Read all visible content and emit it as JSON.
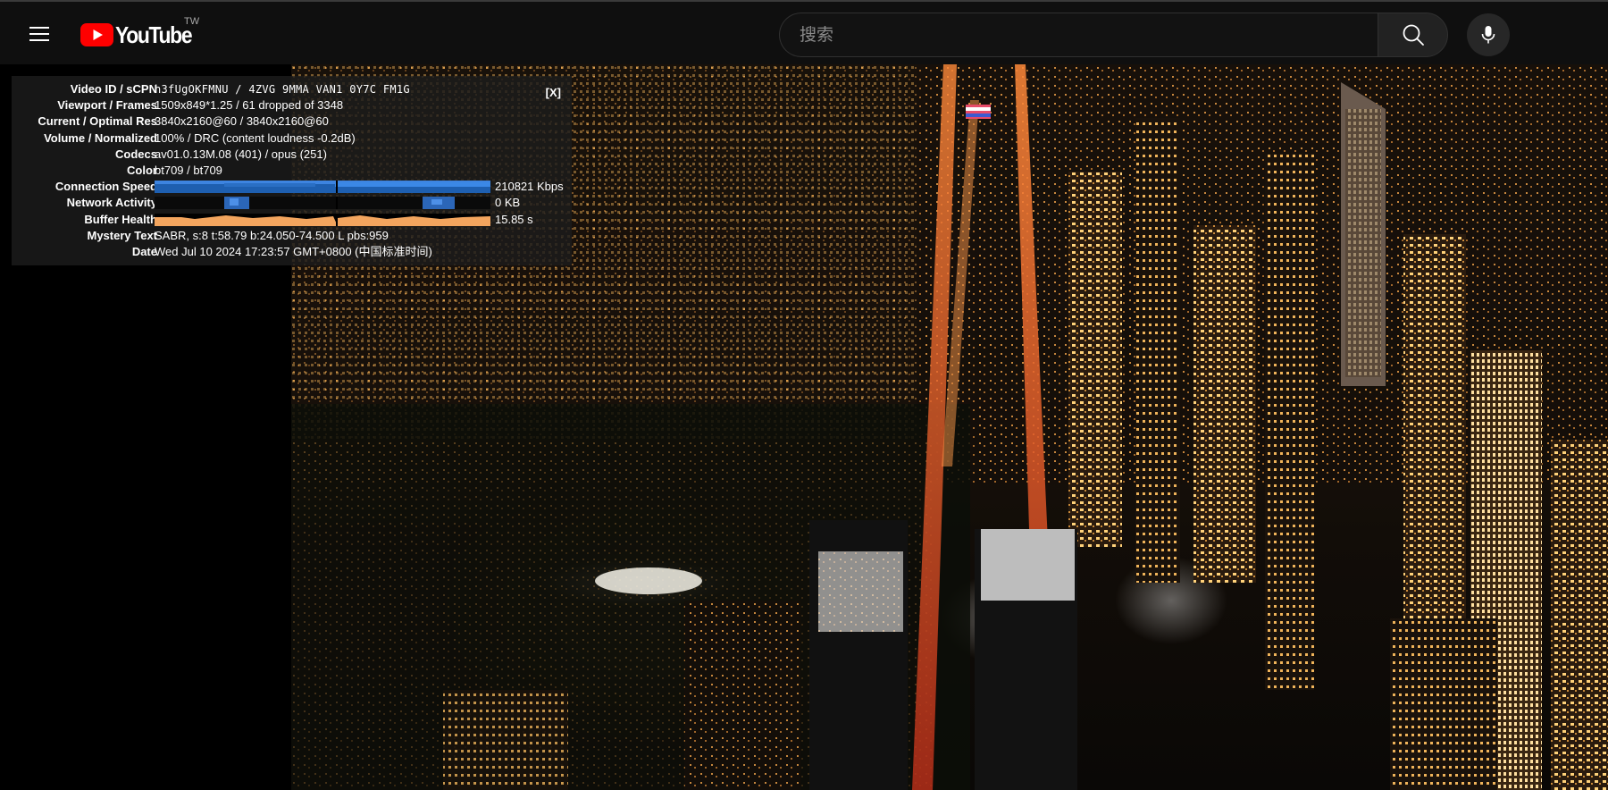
{
  "masthead": {
    "logo_text": "YouTube",
    "region": "TW",
    "search_placeholder": "搜索",
    "icons": {
      "menu": "hamburger-menu-icon",
      "search": "search-icon",
      "mic": "microphone-icon"
    }
  },
  "stats": {
    "close_label": "[X]",
    "rows": [
      {
        "label": "Video ID / sCPN",
        "value": "h3fUgOKFMNU / 4ZVG 9MMA VAN1 0Y7C FM1G"
      },
      {
        "label": "Viewport / Frames",
        "value": "1509x849*1.25 / 61 dropped of 3348"
      },
      {
        "label": "Current / Optimal Res",
        "value": "3840x2160@60 / 3840x2160@60"
      },
      {
        "label": "Volume / Normalized",
        "value": "100% / DRC (content loudness -0.2dB)"
      },
      {
        "label": "Codecs",
        "value": "av01.0.13M.08 (401) / opus (251)"
      },
      {
        "label": "Color",
        "value": "bt709 / bt709"
      },
      {
        "label": "Connection Speed",
        "value": "210821 Kbps"
      },
      {
        "label": "Network Activity",
        "value": "0 KB"
      },
      {
        "label": "Buffer Health",
        "value": "15.85 s"
      },
      {
        "label": "Mystery Text",
        "value": "SABR, s:8 t:58.79 b:24.050-74.500 L pbs:959"
      },
      {
        "label": "Date",
        "value": "Wed Jul 10 2024 17:23:57 GMT+0800 (中国标准时间)"
      }
    ],
    "colors": {
      "connection_graph": "#2a6fc4",
      "network_graph": "#3d7fd6",
      "buffer_graph": "#f3a55e"
    }
  }
}
